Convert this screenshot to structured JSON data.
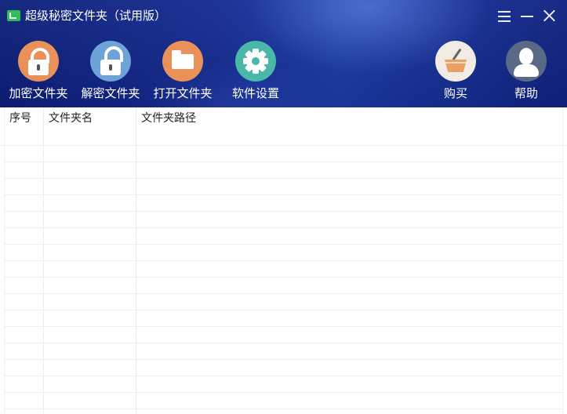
{
  "window": {
    "title": "超级秘密文件夹（试用版）"
  },
  "toolbar": {
    "items": [
      {
        "label": "加密文件夹",
        "icon": "lock-icon",
        "color": "#e8925a"
      },
      {
        "label": "解密文件夹",
        "icon": "unlock-icon",
        "color": "#6da3d6"
      },
      {
        "label": "打开文件夹",
        "icon": "folder-icon",
        "color": "#e8925a"
      },
      {
        "label": "软件设置",
        "icon": "gear-icon",
        "color": "#49b8a8"
      }
    ],
    "right_items": [
      {
        "label": "购买",
        "icon": "basket-icon",
        "color": "#f0ece4"
      },
      {
        "label": "帮助",
        "icon": "user-icon",
        "color": "#5a6a86"
      }
    ]
  },
  "table": {
    "columns": [
      "序号",
      "文件夹名",
      "文件夹路径"
    ],
    "rows": []
  },
  "colors": {
    "header_dark": "#0d1f7a",
    "header_light": "#1b3aa5",
    "app_icon": "#2fbf5a"
  }
}
